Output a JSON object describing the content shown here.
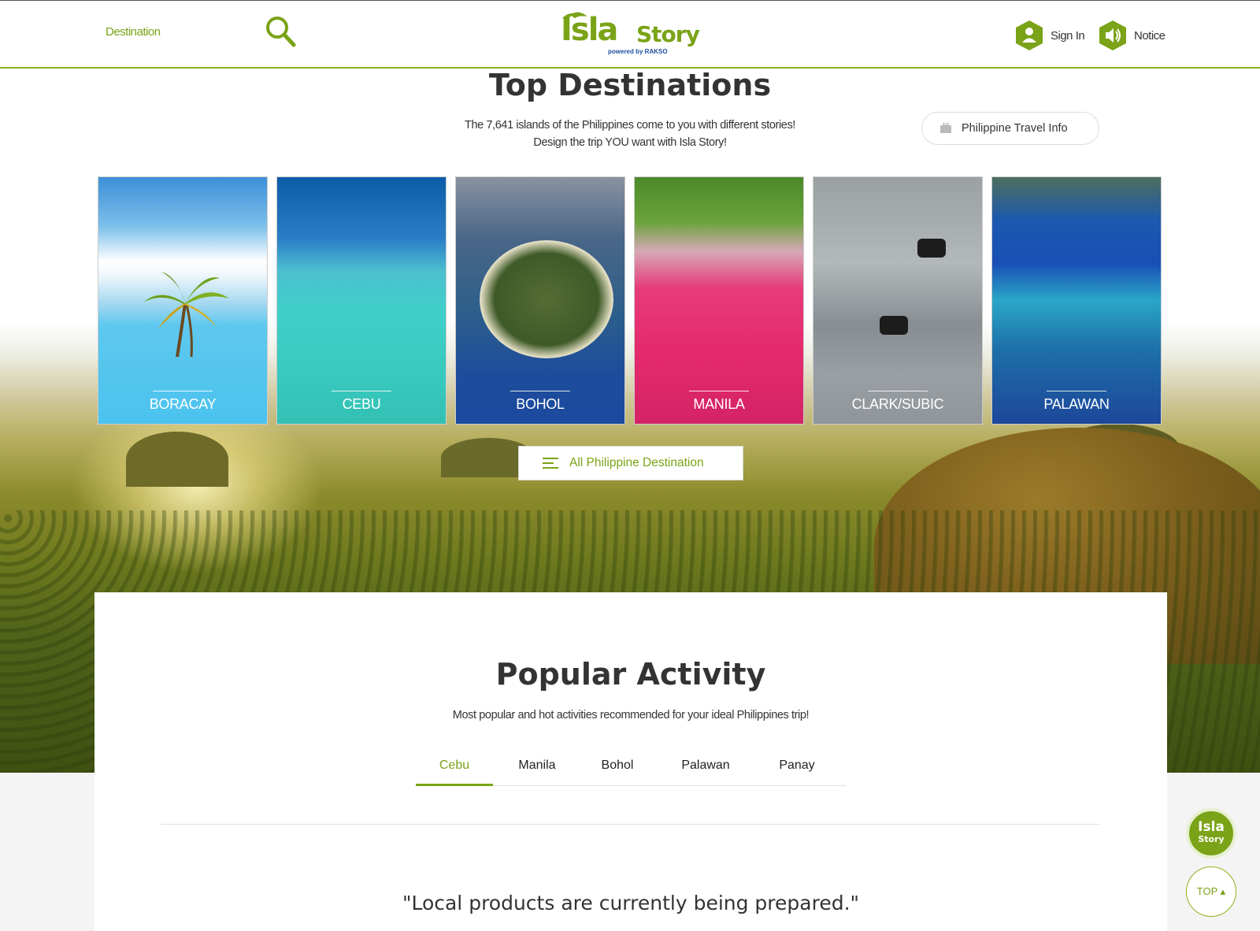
{
  "header": {
    "nav_destination": "Destination",
    "logo": {
      "brand": "Isla",
      "brand_word2": "Story",
      "powered": "powered by RAKSO"
    },
    "signin_label": "Sign In",
    "notice_label": "Notice"
  },
  "hero": {
    "title": "Top Destinations",
    "subtitle_line1": "The 7,641 islands of the Philippines come to you with different stories!",
    "subtitle_line2": "Design the trip YOU want with Isla Story!",
    "travel_info_label": "Philippine Travel Info",
    "destinations": [
      {
        "label": "BORACAY"
      },
      {
        "label": "CEBU"
      },
      {
        "label": "BOHOL"
      },
      {
        "label": "MANILA"
      },
      {
        "label": "CLARK/SUBIC"
      },
      {
        "label": "PALAWAN"
      }
    ],
    "all_destination_label": "All Philippine Destination"
  },
  "activity": {
    "title": "Popular Activity",
    "subtitle": "Most popular and hot activities recommended for your ideal Philippines trip!",
    "tabs": [
      {
        "label": "Cebu",
        "active": true
      },
      {
        "label": "Manila",
        "active": false
      },
      {
        "label": "Bohol",
        "active": false
      },
      {
        "label": "Palawan",
        "active": false
      },
      {
        "label": "Panay",
        "active": false
      }
    ],
    "empty_message": "\"Local products are currently being prepared.\""
  },
  "floating": {
    "logo_top": "Isla",
    "logo_bottom": "Story",
    "top_label": "TOP ▴"
  },
  "colors": {
    "accent": "#7aa317",
    "accent_light": "#8cb31e"
  },
  "icons": [
    "search-icon",
    "user-icon",
    "speaker-icon",
    "luggage-icon",
    "menu-icon"
  ]
}
